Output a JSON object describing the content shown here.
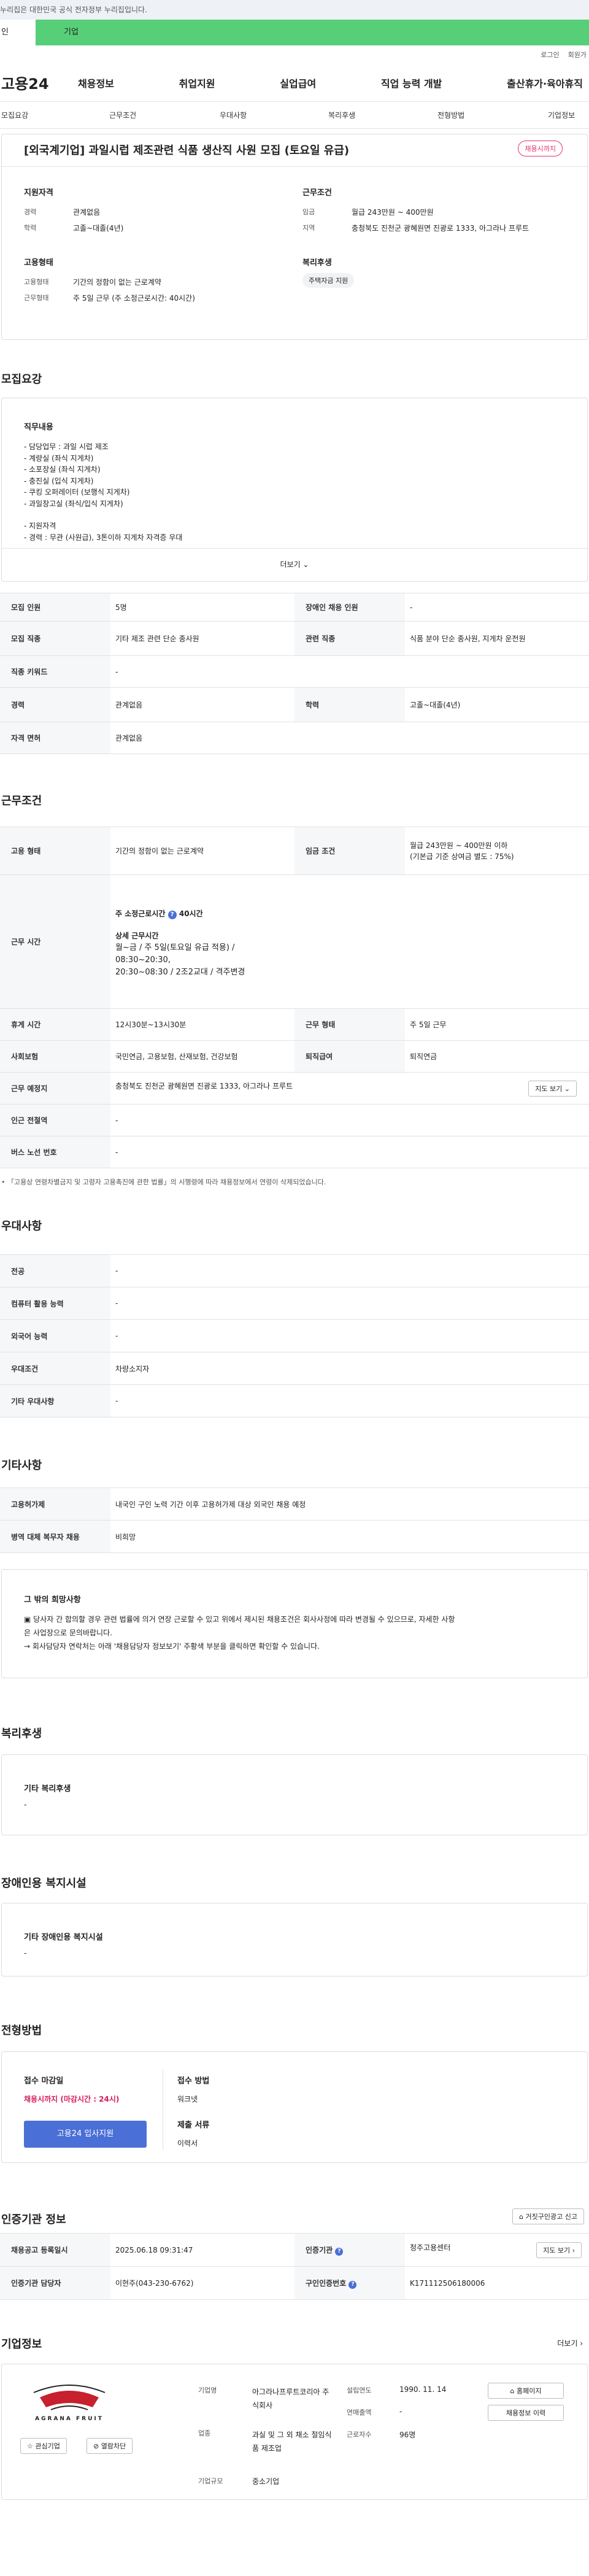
{
  "gov_bar": {
    "text": "누리집은 대한민국 공식 전자정부 누리집입니다."
  },
  "tabs": {
    "person": "인",
    "business": "기업"
  },
  "util": {
    "login": "로그인",
    "signup": "회원가"
  },
  "gnb": {
    "logo": "고용24",
    "menu": [
      "채용정보",
      "취업지원",
      "실업급여",
      "직업 능력 개발",
      "출산휴가·육아휴직"
    ]
  },
  "subnav": [
    "모집요강",
    "근무조건",
    "우대사항",
    "복리후생",
    "전형방법",
    "기업정보"
  ],
  "header": {
    "title": "[외국계기업] 과일시럽 제조관련 식품 생산직 사원 모집 (토요일 유급)",
    "badge": "채용시까지",
    "qual_heading": "지원자격",
    "career_label": "경력",
    "career_value": "관계없음",
    "edu_label": "학력",
    "edu_value": "고졸~대졸(4년)",
    "work_heading": "근무조건",
    "wage_label": "임금",
    "wage_value": "월급 243만원 ~ 400만원",
    "loc_label": "지역",
    "loc_value": "충청북도 진천군 광혜원면 진광로 1333, 아그라나 프루트",
    "emp_heading": "고용형태",
    "emp_type_label": "고용형태",
    "emp_type_value": "기간의 정함이 없는 근로계약",
    "work_form_label": "근무형태",
    "work_form_value": "주 5일 근무 (주 소정근로시간: 40시간)",
    "welfare_heading": "복리후생",
    "welfare_tag": "주택자금 지원"
  },
  "recruit": {
    "title": "모집요강",
    "duty_heading": "직무내용",
    "lines": [
      "- 담당업무 : 과일 시럽 제조",
      "- 계량실 (좌식 지게차)",
      "- 소포장실 (좌식 지게차)",
      "- 충진실 (입식 지게차)",
      "- 쿠킹 오퍼레이터 (보행식 지게차)",
      "- 과일창고실 (좌식/입식 지게차)",
      "",
      "- 지원자격",
      "- 경력 : 무관 (사원급), 3톤이하 지게차 자격증 우대"
    ],
    "more": "더보기",
    "rows": [
      {
        "l1": "모집 인원",
        "v1": "5명",
        "l2": "장애인 채용 인원",
        "v2": "-"
      },
      {
        "l1": "모집 직종",
        "v1": "기타 제조 관련 단순 종사원",
        "l2": "관련 직종",
        "v2": "식품 분야 단순 종사원, 지게차 운전원"
      },
      {
        "l1": "직종 키워드",
        "v1": "-",
        "l2": "",
        "v2": ""
      },
      {
        "l1": "경력",
        "v1": "관계없음",
        "l2": "학력",
        "v2": "고졸~대졸(4년)"
      },
      {
        "l1": "자격 면허",
        "v1": "관계없음",
        "l2": "",
        "v2": ""
      }
    ]
  },
  "work": {
    "title": "근무조건",
    "emp_label": "고용 형태",
    "emp_value": "기간의 정함이 없는 근로계약",
    "wage_label": "임금 조건",
    "wage_value": "월급 243만원 ~ 400만원 이하",
    "wage_sub": "(기본급 기준 상여금 별도 : 75%)",
    "hours_label": "근무 시간",
    "hours_title": "주 소정근로시간",
    "hours_value": "40시간",
    "detail_title": "상세 근무시간",
    "detail_lines": [
      "월~금 / 주 5일(토요일 유급 적용) /",
      "08:30~20:30,",
      "20:30~08:30 / 2조2교대 / 격주변경"
    ],
    "break_label": "휴게 시간",
    "break_value": "12시30분~13시30분",
    "shift_label": "근무 형태",
    "shift_value": "주 5일 근무",
    "ins_label": "사회보험",
    "ins_value": "국민연금, 고용보험, 산재보험, 건강보험",
    "ret_label": "퇴직급여",
    "ret_value": "퇴직연금",
    "place_label": "근무 예정지",
    "place_value": "충청북도 진천군 광혜원면 진광로 1333, 아그라나 프루트",
    "map_button": "지도 보기",
    "subway_label": "인근 전철역",
    "subway_value": "-",
    "bus_label": "버스 노선 번호",
    "bus_value": "-",
    "note": "「고용상 연령차별금지 및 고령자 고용촉진에 관한 법률」의 시행령에 따라 채용정보에서 연령이 삭제되었습니다."
  },
  "pref": {
    "title": "우대사항",
    "rows": [
      {
        "label": "전공",
        "value": "-"
      },
      {
        "label": "컴퓨터 활용 능력",
        "value": "-"
      },
      {
        "label": "외국어 능력",
        "value": "-"
      },
      {
        "label": "우대조건",
        "value": "차량소지자"
      },
      {
        "label": "기타 우대사항",
        "value": "-"
      }
    ]
  },
  "etc": {
    "title": "기타사항",
    "rows": [
      {
        "label": "고용허가제",
        "value": "내국인 구인 노력 기간 이후 고용허가제 대상 외국인 채용 예정"
      },
      {
        "label": "병역 대체 복무자 채용",
        "value": "비희망"
      }
    ],
    "box_title": "그 밖의 희망사항",
    "box_lines": [
      "▣ 당사자 간 합의할 경우 관련 법률에 의거 연장 근로할 수 있고 위에서 제시된 채용조건은 회사사정에 따라 변경될 수 있으므로, 자세한 사항",
      "은 사업장으로 문의바랍니다.",
      "→ 회사담당자 연락처는 아래 '채용담당자 정보보기' 주황색 부분을 클릭하면 확인할 수 있습니다."
    ]
  },
  "welfare": {
    "title": "복리후생",
    "sub": "기타 복리후생",
    "value": "-"
  },
  "disab": {
    "title": "장애인용 복지시설",
    "sub": "기타 장애인용 복지시설",
    "value": "-"
  },
  "select": {
    "title": "전형방법",
    "deadline_label": "접수 마감일",
    "deadline_value": "채용시까지 (마감시간 : 24시)",
    "apply_button": "고용24 입사지원",
    "method_label": "접수 방법",
    "method_value": "워크넷",
    "docs_label": "제출 서류",
    "docs_value": "이력서"
  },
  "auth": {
    "title": "인증기관 정보",
    "report_button": "거짓구인광고 신고",
    "reg_label": "채용공고 등록일시",
    "reg_value": "2025.06.18 09:31:47",
    "org_label": "인증기관",
    "org_value": "청주고용센터",
    "org_button": "지도 보기",
    "mgr_label": "인증기관 담당자",
    "mgr_value": "이현주(043-230-6762)",
    "no_label": "구인인증번호",
    "no_value": "K171112506180006"
  },
  "company": {
    "title": "기업정보",
    "more": "더보기",
    "logo_text": "AGRANA FRUIT",
    "interest_button": "관심기업",
    "block_button": "열람차단",
    "name_label": "기업명",
    "name_value": "아그라나프루트코리아 주식회사",
    "ind_label": "업종",
    "ind_value": "과실 및 그 외 채소 절임식품 제조업",
    "size_label": "기업규모",
    "size_value": "중소기업",
    "founded_label": "설립연도",
    "founded_value": "1990. 11. 14",
    "sales_label": "연매출액",
    "sales_value": "-",
    "emp_label": "근로자수",
    "emp_value": "96명",
    "home_button": "홈페이지",
    "jobs_button": "채용정보 이력"
  },
  "colors": {
    "accent": "#57cf79",
    "apply": "#4a6fd6",
    "deadline": "#d81b60",
    "badge": "#e5336a"
  }
}
